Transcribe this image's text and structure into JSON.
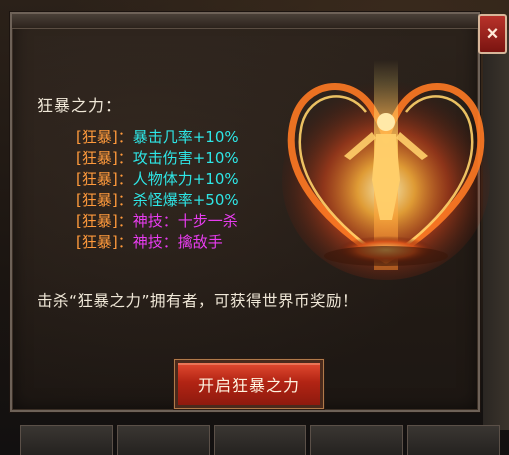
{
  "dialog": {
    "title": "狂暴之力：",
    "attributes": [
      {
        "tag": "[狂暴]",
        "colon": "：",
        "value": "暴击几率+10%",
        "color": "#2ee6e6"
      },
      {
        "tag": "[狂暴]",
        "colon": "：",
        "value": "攻击伤害+10%",
        "color": "#2ee6e6"
      },
      {
        "tag": "[狂暴]",
        "colon": "：",
        "value": "人物体力+10%",
        "color": "#2ee6e6"
      },
      {
        "tag": "[狂暴]",
        "colon": "：",
        "value": "杀怪爆率+50%",
        "color": "#2ee6e6"
      },
      {
        "tag": "[狂暴]",
        "colon": "：",
        "value": "神技：十步一杀",
        "color": "#e83cf0"
      },
      {
        "tag": "[狂暴]",
        "colon": "：",
        "value": "神技：擒敌手",
        "color": "#e83cf0"
      }
    ],
    "description": "击杀“狂暴之力”拥有者，可获得世界币奖励！",
    "action_button": "开启狂暴之力",
    "close_label": "×"
  },
  "colors": {
    "tag": "#ff9a3c",
    "text": "#f0e8d8",
    "button": "#b22414",
    "close": "#b8322a"
  }
}
